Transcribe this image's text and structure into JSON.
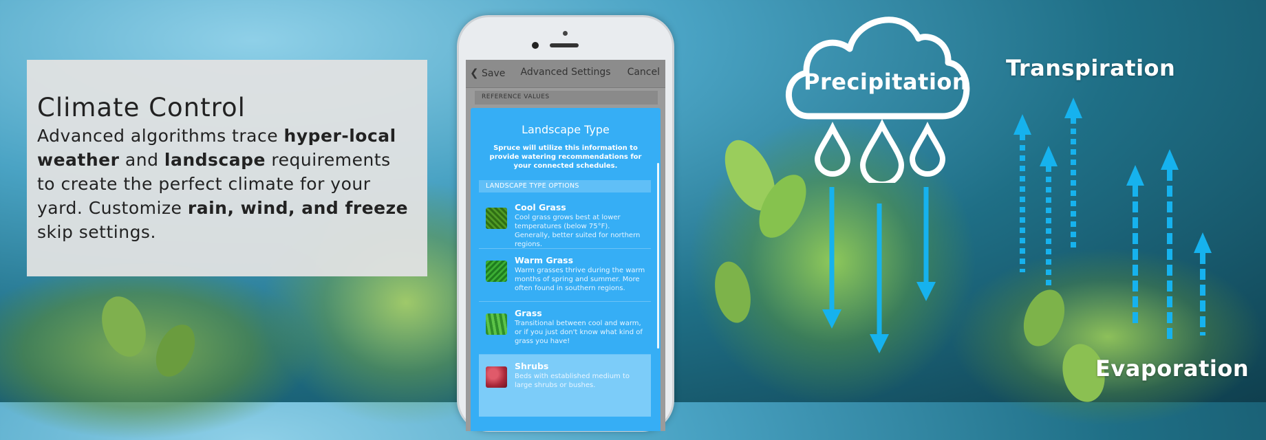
{
  "info": {
    "title": "Climate Control",
    "body_parts": [
      "Advanced algorithms trace ",
      "hyper-local weather",
      " and ",
      "landscape",
      " requirements to create the perfect climate for your yard. Customize ",
      "rain, wind, and freeze",
      " skip settings."
    ]
  },
  "phone": {
    "nav": {
      "save": "Save",
      "title": "Advanced Settings",
      "cancel": "Cancel"
    },
    "section_label": "REFERENCE VALUES",
    "modal": {
      "title": "Landscape Type",
      "subtitle": "Spruce will utilize this information to provide watering recommendations for your connected schedules.",
      "options_header": "LANDSCAPE TYPE OPTIONS",
      "options": [
        {
          "name": "Cool Grass",
          "desc": "Cool grass grows best at lower temperatures (below 75°F). Generally, better suited for northern regions.",
          "thumb_color": "#3e8a1e"
        },
        {
          "name": "Warm Grass",
          "desc": "Warm grasses thrive during the warm months of spring and summer. More often found in southern regions.",
          "thumb_color": "#2f9a2a"
        },
        {
          "name": "Grass",
          "desc": "Transitional between cool and warm, or if you just don't know what kind of grass you have!",
          "thumb_color": "#3aa63a"
        },
        {
          "name": "Shrubs",
          "desc": "Beds with established medium to large shrubs or bushes.",
          "thumb_color": "#a8283a"
        }
      ]
    }
  },
  "diagram": {
    "precipitation": "Precipitation",
    "transpiration": "Transpiration",
    "evaporation": "Evaporation",
    "arrow_color": "#16b2ee"
  }
}
